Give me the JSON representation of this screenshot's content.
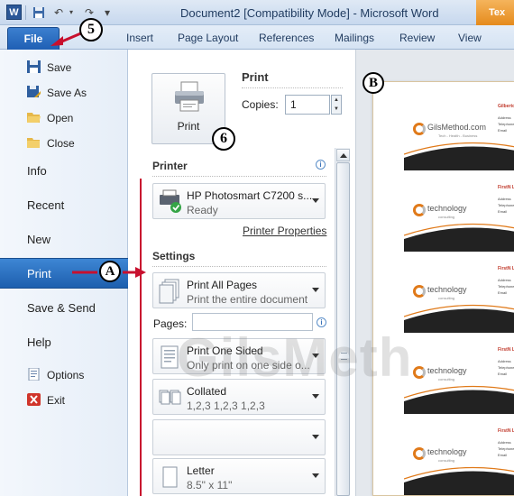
{
  "window": {
    "title": "Document2 [Compatibility Mode] - Microsoft Word",
    "app_icon_letter": "W",
    "contextual_tab": "Tex"
  },
  "ribbon": {
    "file_tab": "File",
    "tabs": [
      "Insert",
      "Page Layout",
      "References",
      "Mailings",
      "Review",
      "View"
    ]
  },
  "backstage": {
    "small_items": [
      {
        "label": "Save",
        "icon": "save-icon"
      },
      {
        "label": "Save As",
        "icon": "save-as-icon"
      },
      {
        "label": "Open",
        "icon": "open-folder-icon"
      },
      {
        "label": "Close",
        "icon": "close-folder-icon"
      }
    ],
    "big_items": [
      "Info",
      "Recent",
      "New",
      "Print",
      "Save & Send",
      "Help"
    ],
    "active_item": "Print",
    "footer_items": [
      {
        "label": "Options",
        "icon": "options-icon"
      },
      {
        "label": "Exit",
        "icon": "exit-icon"
      }
    ]
  },
  "print_panel": {
    "print_button": "Print",
    "heading": "Print",
    "copies_label": "Copies:",
    "copies_value": "1",
    "printer_heading": "Printer",
    "printer_name": "HP Photosmart C7200 s...",
    "printer_status": "Ready",
    "printer_properties": "Printer Properties",
    "settings_heading": "Settings",
    "pages_label": "Pages:",
    "pages_value": "",
    "settings": [
      {
        "main": "Print All Pages",
        "sub": "Print the entire document"
      },
      {
        "main": "Print One Sided",
        "sub": "Only print on one side o..."
      },
      {
        "main": "Collated",
        "sub": "1,2,3    1,2,3    1,2,3"
      },
      {
        "main": "",
        "sub": ""
      },
      {
        "main": "Letter",
        "sub": "8.5\" x 11\""
      }
    ]
  },
  "preview": {
    "cards": [
      {
        "brand": "GilsMethod.com",
        "tagline": "Tech - Health - Business",
        "name": "Gilberto J",
        "rows": [
          "Address",
          "Telephone",
          "Email"
        ]
      },
      {
        "brand": "technology",
        "tagline": "consulting",
        "name": "FirstN La",
        "rows": [
          "Address",
          "Telephone",
          "Email"
        ]
      },
      {
        "brand": "technology",
        "tagline": "consulting",
        "name": "FirstN La",
        "rows": [
          "Address",
          "Telephone",
          "Email"
        ]
      },
      {
        "brand": "technology",
        "tagline": "consulting",
        "name": "FirstN La",
        "rows": [
          "Address",
          "Telephone",
          "Email"
        ]
      },
      {
        "brand": "technology",
        "tagline": "consulting",
        "name": "FirstN La",
        "rows": [
          "Address",
          "Telephone",
          "Email"
        ]
      }
    ]
  },
  "annotations": {
    "file_step": "5",
    "print_button_step": "6",
    "print_nav_marker": "A",
    "preview_marker": "B",
    "watermark": "GilsMeth",
    "arrow_color": "#c8102e"
  }
}
